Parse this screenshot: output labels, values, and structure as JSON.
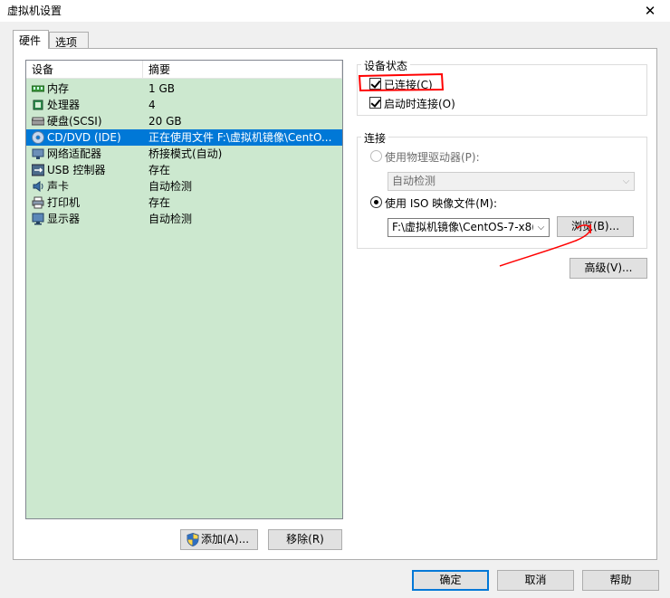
{
  "window": {
    "title": "虚拟机设置",
    "close_glyph": "✕"
  },
  "tabs": [
    {
      "label": "硬件"
    },
    {
      "label": "选项"
    }
  ],
  "device_list": {
    "columns": [
      "设备",
      "摘要"
    ],
    "rows": [
      {
        "name": "内存",
        "summary": "1 GB",
        "icon": "memory-icon"
      },
      {
        "name": "处理器",
        "summary": "4",
        "icon": "processor-icon"
      },
      {
        "name": "硬盘(SCSI)",
        "summary": "20 GB",
        "icon": "harddisk-icon"
      },
      {
        "name": "CD/DVD (IDE)",
        "summary": "正在使用文件 F:\\虚拟机镜像\\CentO...",
        "icon": "cd-dvd-icon",
        "selected": true
      },
      {
        "name": "网络适配器",
        "summary": "桥接模式(自动)",
        "icon": "network-adapter-icon"
      },
      {
        "name": "USB 控制器",
        "summary": "存在",
        "icon": "usb-icon"
      },
      {
        "name": "声卡",
        "summary": "自动检测",
        "icon": "sound-card-icon"
      },
      {
        "name": "打印机",
        "summary": "存在",
        "icon": "printer-icon"
      },
      {
        "name": "显示器",
        "summary": "自动检测",
        "icon": "display-icon"
      }
    ]
  },
  "list_buttons": {
    "add": "添加(A)...",
    "remove": "移除(R)"
  },
  "device_status": {
    "title": "设备状态",
    "connected": {
      "label": "已连接(C)",
      "checked": true
    },
    "connect_at_power_on": {
      "label": "启动时连接(O)",
      "checked": true
    }
  },
  "connection": {
    "title": "连接",
    "physical_drive": {
      "label": "使用物理驱动器(P):",
      "selected": false,
      "enabled": false
    },
    "physical_drive_combo": "自动检测",
    "iso": {
      "label": "使用 ISO 映像文件(M):",
      "selected": true
    },
    "iso_path": "F:\\虚拟机镜像\\CentOS-7-x8(",
    "browse_label": "浏览(B)..."
  },
  "advanced_label": "高级(V)...",
  "dialog_buttons": {
    "ok": "确定",
    "cancel": "取消",
    "help": "帮助"
  },
  "colors": {
    "list_bg": "#cce8cf",
    "selection": "#0078d7",
    "annotation": "#ff0000"
  }
}
